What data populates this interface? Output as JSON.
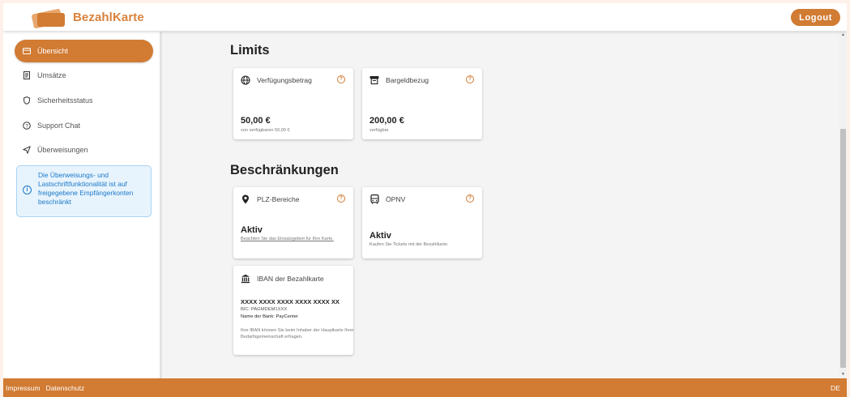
{
  "header": {
    "brand": "BezahlKarte",
    "logout_label": "Logout"
  },
  "sidebar": {
    "items": [
      {
        "label": "Übersicht",
        "icon": "card-icon",
        "active": true
      },
      {
        "label": "Umsätze",
        "icon": "receipt-icon",
        "active": false
      },
      {
        "label": "Sicherheitsstatus",
        "icon": "shield-icon",
        "active": false
      },
      {
        "label": "Support Chat",
        "icon": "help-circle-icon",
        "active": false
      },
      {
        "label": "Überweisungen",
        "icon": "send-icon",
        "active": false
      }
    ],
    "info": "Die Überweisungs- und Lastschriftfunktionalität ist auf freigegebene Empfängerkonten beschränkt"
  },
  "limits": {
    "title": "Limits",
    "cards": [
      {
        "title": "Verfügungsbetrag",
        "icon": "globe-icon",
        "value": "50,00 €",
        "sub": "von verfügbaren 50,00 €"
      },
      {
        "title": "Bargeldbezug",
        "icon": "atm-icon",
        "value": "200,00 €",
        "sub": "verfügbar"
      }
    ]
  },
  "restrictions": {
    "title": "Beschränkungen",
    "cards": [
      {
        "title": "PLZ-Bereiche",
        "icon": "location-pin-icon",
        "value": "Aktiv",
        "sub": "Beachten Sie das Einsatzgebiet für Ihre Karte."
      },
      {
        "title": "ÖPNV",
        "icon": "bus-icon",
        "value": "Aktiv",
        "sub": "Kaufen Sie Tickets mit der Bezahlkarte."
      }
    ],
    "iban": {
      "title": "IBAN der Bezahlkarte",
      "icon": "bank-icon",
      "iban": "XXXX XXXX XXXX XXXX XXXX XX",
      "bic": "BIC: PAGMDEM1XXX",
      "bank": "Name der Bank: PayCenter",
      "note": "Ihre IBAN können Sie beim Inhaber der Hauptkarte Ihrer Bedarfsgemeinschaft erfragen."
    }
  },
  "footer": {
    "impressum": "Impressum",
    "datenschutz": "Datenschutz",
    "language": "DE"
  },
  "colors": {
    "accent": "#d17b33",
    "info_text": "#1b78c8",
    "info_bg": "#e8f4fd"
  }
}
